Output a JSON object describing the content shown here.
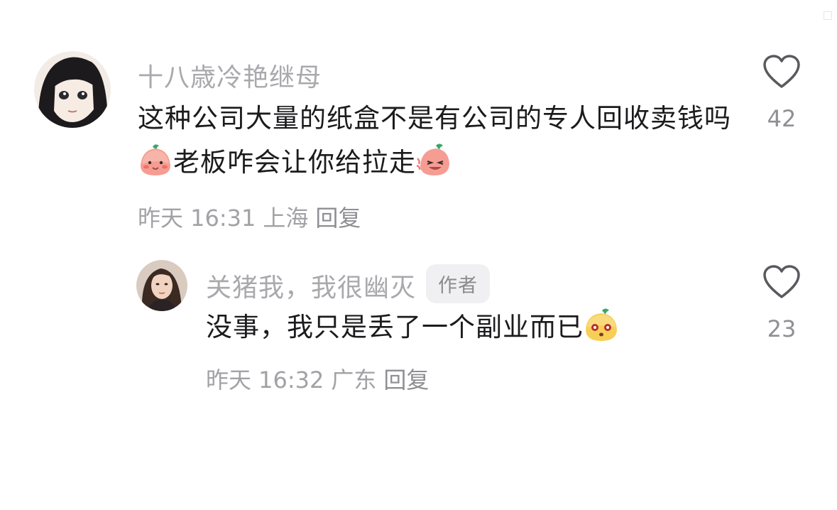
{
  "comments": [
    {
      "username": "十八歳冷艳继母",
      "text_part1": "这种公司大量的纸盒不是有公司的专人回收卖钱吗",
      "emoji1": "smiling-radish-emoji",
      "text_part2": "老板咋会让你给拉走",
      "emoji2": "laughing-radish-emoji",
      "time": "昨天 16:31",
      "location": "上海",
      "reply": "回复",
      "likes": "42",
      "avatar": "anime-girl-avatar"
    },
    {
      "username": "关猪我，我很幽灭",
      "badge": "作者",
      "text_part1": "没事，我只是丢了一个副业而已",
      "emoji1": "surprised-yellow-emoji",
      "time": "昨天 16:32",
      "location": "广东",
      "reply": "回复",
      "likes": "23",
      "avatar": "woman-photo-avatar"
    }
  ],
  "colors": {
    "username": "#a9a9ad",
    "text": "#1b1b1d",
    "meta": "#a2a2a6",
    "badge_bg": "#f0f0f2"
  }
}
